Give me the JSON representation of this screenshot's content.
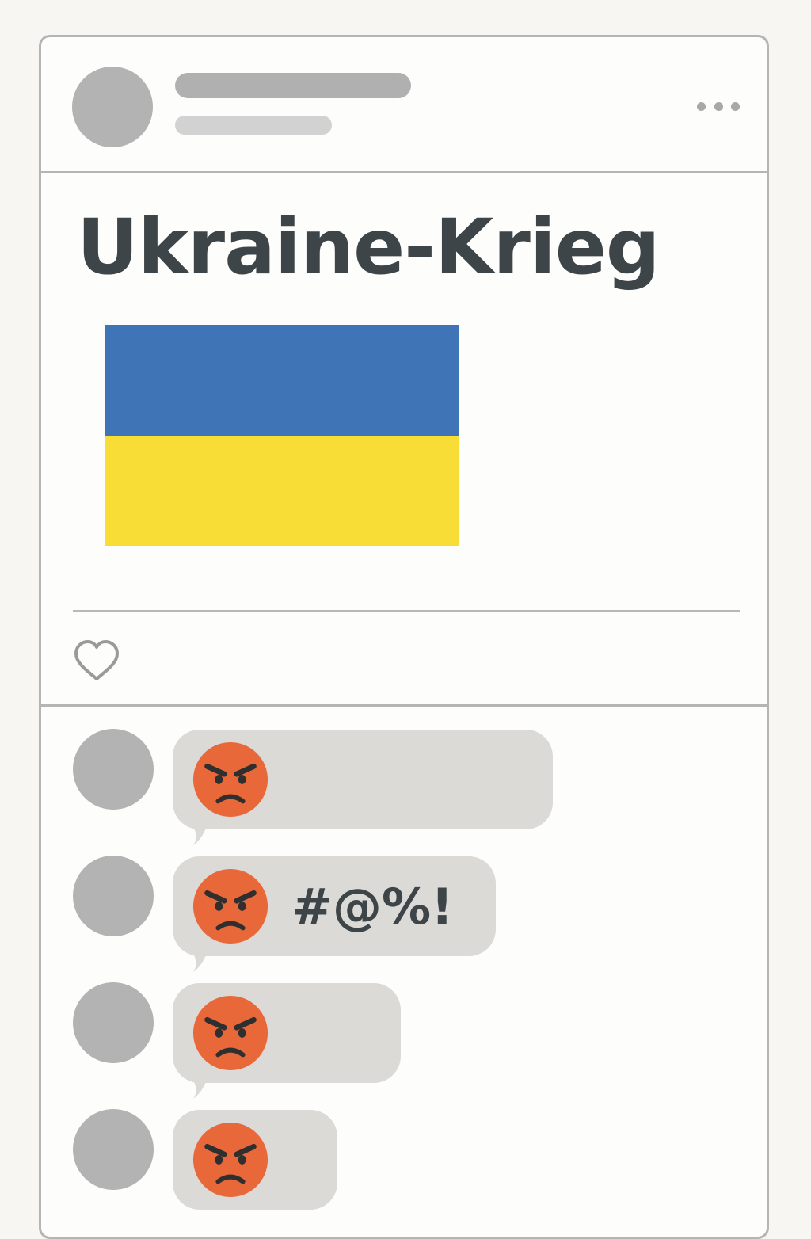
{
  "post": {
    "title": "Ukraine-Krieg",
    "flag_colors": {
      "top": "#3f74b6",
      "bottom": "#f7dd35"
    }
  },
  "header": {
    "avatar_color": "#b3b3b3",
    "more_icon": "more-horizontal-icon"
  },
  "actions": {
    "like_icon": "heart-outline-icon"
  },
  "comments": [
    {
      "icon": "angry-face-icon",
      "text": ""
    },
    {
      "icon": "angry-face-icon",
      "text": "#@%!"
    },
    {
      "icon": "angry-face-icon",
      "text": ""
    },
    {
      "icon": "angry-face-icon",
      "text": ""
    }
  ],
  "colors": {
    "card_border": "#b5b5b3",
    "bubble": "#dcdad7",
    "angry_face": "#e8683a",
    "title_text": "#3e4549"
  }
}
